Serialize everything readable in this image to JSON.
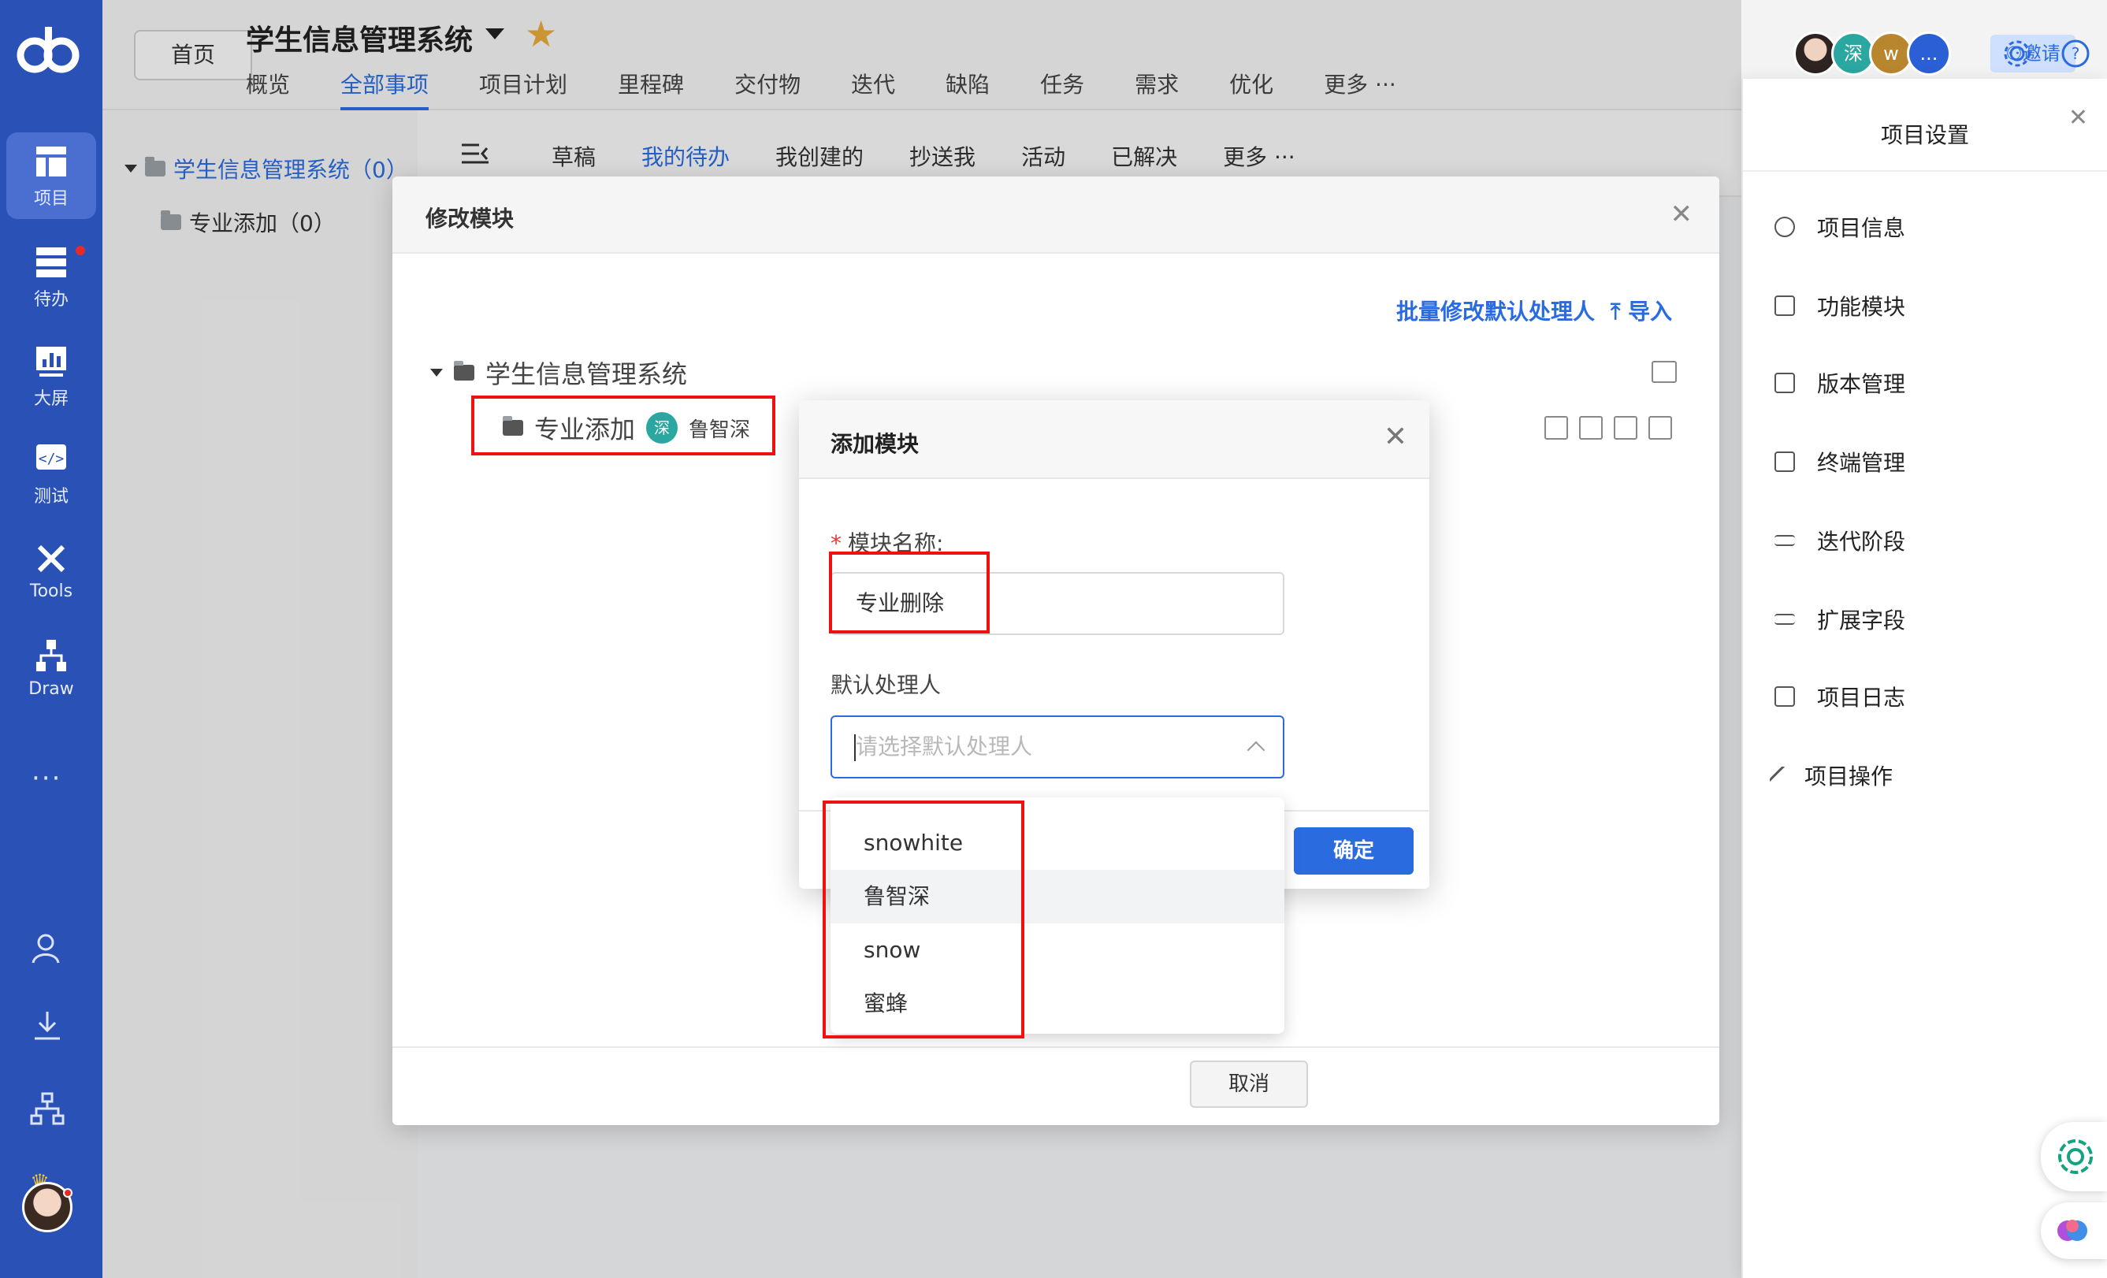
{
  "nav": {
    "items": [
      {
        "label": "项目",
        "icon": "project-icon"
      },
      {
        "label": "待办",
        "icon": "todo-icon"
      },
      {
        "label": "大屏",
        "icon": "dashboard-icon"
      },
      {
        "label": "测试",
        "icon": "code-test-icon"
      },
      {
        "label": "Tools",
        "icon": "tools-icon"
      },
      {
        "label": "Draw",
        "icon": "draw-icon"
      }
    ],
    "more": "···"
  },
  "header": {
    "home": "首页",
    "project_title": "学生信息管理系统",
    "tabs": [
      "概览",
      "全部事项",
      "项目计划",
      "里程碑",
      "交付物",
      "迭代",
      "缺陷",
      "任务",
      "需求",
      "优化",
      "更多 ···"
    ],
    "active_tab": "全部事项",
    "avatars": [
      "",
      "深",
      "w",
      "..."
    ],
    "invite": "邀请"
  },
  "tree": {
    "root": "学生信息管理系统（0）",
    "child": "专业添加（0）"
  },
  "subtoolbar": {
    "tabs": [
      "草稿",
      "我的待办",
      "我创建的",
      "抄送我",
      "活动",
      "已解决",
      "更多 ···"
    ]
  },
  "modify_dialog": {
    "title": "修改模块",
    "batch_link": "批量修改默认处理人",
    "import_link": "导入",
    "root": "学生信息管理系统",
    "child": "专业添加",
    "owner_badge": "深",
    "owner": "鲁智深",
    "cancel": "取消"
  },
  "add_dialog": {
    "title": "添加模块",
    "name_label": "模块名称:",
    "name_value": "专业删除",
    "owner_label": "默认处理人",
    "owner_placeholder": "请选择默认处理人",
    "ok": "确定",
    "options": [
      "snowhite",
      "鲁智深",
      "snow",
      "蜜蜂"
    ]
  },
  "settings_panel": {
    "title": "项目设置",
    "items": [
      "项目信息",
      "功能模块",
      "版本管理",
      "终端管理",
      "迭代阶段",
      "扩展字段",
      "项目日志",
      "项目操作"
    ]
  },
  "colors": {
    "nav_bg": "#2a51b5",
    "accent": "#2b6be0",
    "highlight_box": "#e11111",
    "star": "#e9a93a"
  }
}
